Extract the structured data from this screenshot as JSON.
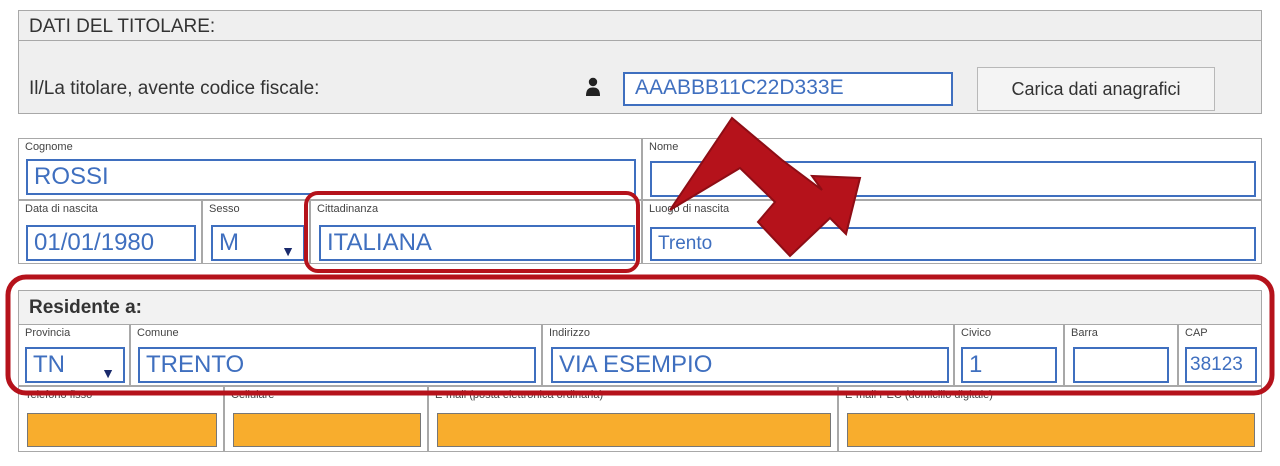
{
  "header": {
    "title": "DATI DEL TITOLARE:",
    "label": "Il/La titolare, avente codice fiscale:",
    "codice_fiscale": "AAABBB11C22D333E",
    "load_button": "Carica dati anagrafici",
    "icon": "user-icon"
  },
  "anagrafica": {
    "cognome_label": "Cognome",
    "cognome_value": "ROSSI",
    "nome_label": "Nome",
    "nome_value": "",
    "data_nascita_label": "Data di nascita",
    "data_nascita_value": "01/01/1980",
    "sesso_label": "Sesso",
    "sesso_value": "M",
    "cittadinanza_label": "Cittadinanza",
    "cittadinanza_value": "ITALIANA",
    "luogo_nascita_label": "Luogo di nascita",
    "luogo_nascita_value": "Trento"
  },
  "residenza": {
    "title": "Residente a:",
    "provincia_label": "Provincia",
    "provincia_value": "TN",
    "comune_label": "Comune",
    "comune_value": "TRENTO",
    "indirizzo_label": "Indirizzo",
    "indirizzo_value": "VIA ESEMPIO",
    "civico_label": "Civico",
    "civico_value": "1",
    "barra_label": "Barra",
    "barra_value": "",
    "cap_label": "CAP",
    "cap_value": "38123"
  },
  "contatti": {
    "telefono_label": "Telefono fisso",
    "cellulare_label": "Cellulare",
    "email_label": "E-mail (posta elettronica ordinaria)",
    "pec_label": "E-mail PEC (domicilio digitale)"
  },
  "colors": {
    "highlight": "#b5121b",
    "field_blue": "#3f6fbf",
    "orange_fill": "#f8ad2d"
  }
}
